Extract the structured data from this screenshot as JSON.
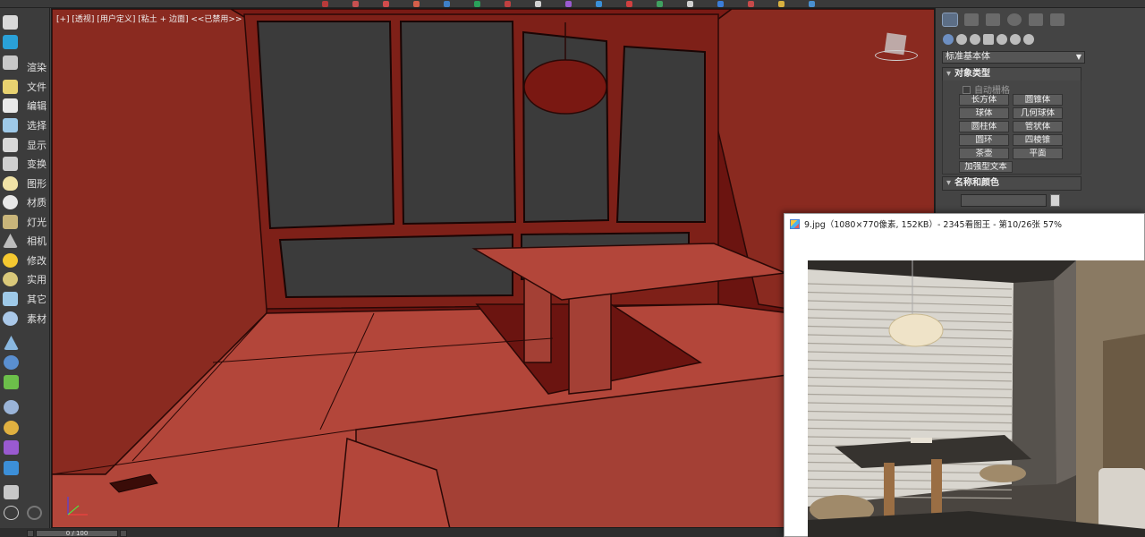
{
  "app": {
    "name": "3ds Max"
  },
  "toolbar": {
    "icon_colors": [
      "#b83a3a",
      "#c85050",
      "#d14c4c",
      "#d65f4a",
      "#3e80c8",
      "#2aa05a",
      "#c04040",
      "#d0d0d0",
      "#9a5ad0",
      "#3a8fd8",
      "#d04040",
      "#40a060",
      "#cfcfcf",
      "#3b7dd8",
      "#c64a4a",
      "#d8b040",
      "#4a90d0"
    ]
  },
  "sidebar": {
    "items": [
      {
        "label": "",
        "icon": "teapot-icon",
        "color": "#d9d9d9"
      },
      {
        "label": "",
        "icon": "max-logo-icon",
        "color": "#2aa1d8"
      },
      {
        "label": "",
        "icon": "media-icon",
        "color": "#c8c8c8"
      },
      {
        "label": "渲染",
        "icon": "render-icon",
        "color": "#e8d270"
      },
      {
        "label": "文件",
        "icon": "file-icon",
        "color": "#e9e9e9"
      },
      {
        "label": "编辑",
        "icon": "edit-icon",
        "color": "#9ec9e8"
      },
      {
        "label": "选择",
        "icon": "select-icon",
        "color": "#d8d8d8"
      },
      {
        "label": "显示",
        "icon": "display-icon",
        "color": "#cfcfcf"
      },
      {
        "label": "变换",
        "icon": "transform-icon",
        "color": "#e6e6e6"
      },
      {
        "label": "图形",
        "icon": "shape-icon",
        "color": "#f0e2a6"
      },
      {
        "label": "材质",
        "icon": "material-icon",
        "color": "#e8e8e8"
      },
      {
        "label": "灯光",
        "icon": "teapot-small-icon",
        "color": "#c9b57a"
      },
      {
        "label": "相机",
        "icon": "camera-icon",
        "color": "#bdbdbd"
      },
      {
        "label": "修改",
        "icon": "sun-icon",
        "color": "#f5c830"
      },
      {
        "label": "实用",
        "icon": "sphere-icon",
        "color": "#d9c87a"
      },
      {
        "label": "其它",
        "icon": "grid-icon",
        "color": "#9ec9e8"
      },
      {
        "label": "素材",
        "icon": "library-icon",
        "color": "#aac8e8"
      }
    ],
    "extra_icons": [
      {
        "icon": "tool-icon",
        "color": "#8ab8e0"
      },
      {
        "icon": "gear-blue-icon",
        "color": "#5a8fd0"
      },
      {
        "icon": "plant-icon",
        "color": "#6cbf4a"
      },
      {
        "icon": "globe-icon",
        "color": "#9ab4d8"
      },
      {
        "icon": "palette-icon",
        "color": "#e0b040"
      },
      {
        "icon": "plugin-icon",
        "color": "#9a5ad0"
      },
      {
        "icon": "window-icon",
        "color": "#3c8fd8"
      },
      {
        "icon": "map-icon",
        "color": "#c8c8c8"
      },
      {
        "icon": "help-icon",
        "color": "#d0d0d0"
      }
    ]
  },
  "viewport": {
    "label": "[+] [透视] [用户定义] [粘土 + 边面] <<已禁用>>",
    "bg_color": "#6b1410",
    "clay_color": "#b3463a"
  },
  "timeline": {
    "frame_display": "0 / 100"
  },
  "command_panel": {
    "category_dropdown": "标准基本体",
    "rollout_object_type": "对象类型",
    "autogrid_label": "自动栅格",
    "object_buttons": [
      "长方体",
      "圆锥体",
      "球体",
      "几何球体",
      "圆柱体",
      "管状体",
      "圆环",
      "四棱锥",
      "茶壶",
      "平面",
      "加强型文本"
    ],
    "rollout_name_color": "名称和颜色",
    "name_value": "",
    "swatch_color": "#d5d5d5"
  },
  "viewer": {
    "title": "9.jpg（1080×770像素, 152KB）- 2345看图王 - 第10/26张 57%"
  }
}
